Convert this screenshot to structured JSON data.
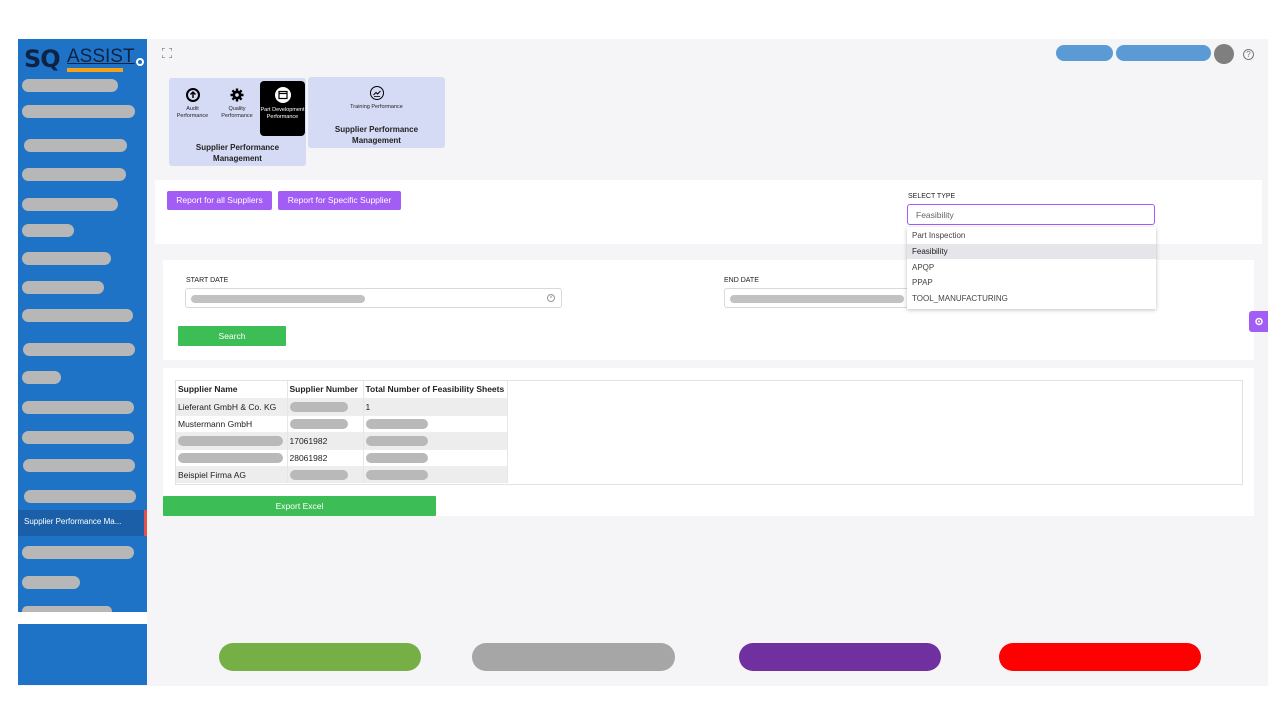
{
  "brand": {
    "logo_sq": "SQ",
    "logo_assist": "ASSIST"
  },
  "sidebar": {
    "active_item": "Supplier Performance Ma..."
  },
  "modules": {
    "group1": {
      "title": "Supplier Performance Management",
      "items": [
        {
          "label": "Audit Performance",
          "icon": "upload-circle-icon"
        },
        {
          "label": "Quality Performance",
          "icon": "gear-icon"
        },
        {
          "label": "Part Development Performance",
          "icon": "window-icon"
        }
      ]
    },
    "group2": {
      "title": "Supplier Performance Management",
      "items": [
        {
          "label": "Training Performance",
          "icon": "chart-line-icon"
        }
      ]
    }
  },
  "report": {
    "all_suppliers_label": "Report for all Suppliers",
    "specific_supplier_label": "Report for Specific Supplier",
    "select_type_label": "SELECT TYPE",
    "select_type_value": "Feasibility",
    "options": [
      "Part Inspection",
      "Feasibility",
      "APQP",
      "PPAP",
      "TOOL_MANUFACTURING"
    ],
    "selected_option": "Feasibility"
  },
  "filters": {
    "start_date_label": "START DATE",
    "end_date_label": "END DATE",
    "search_label": "Search"
  },
  "table": {
    "headers": [
      "Supplier Name",
      "Supplier Number",
      "Total Number of Feasibility Sheets"
    ],
    "rows": [
      {
        "name": "Lieferant GmbH & Co. KG",
        "number": "",
        "total": "1"
      },
      {
        "name": "Mustermann GmbH",
        "number": "",
        "total": ""
      },
      {
        "name": "",
        "number": "17061982",
        "total": ""
      },
      {
        "name": "",
        "number": "28061982",
        "total": ""
      },
      {
        "name": "Beispiel Firma AG",
        "number": "",
        "total": ""
      }
    ]
  },
  "export_label": "Export Excel",
  "colors": {
    "sidebar": "#1f73c6",
    "accent_purple": "#a25df5",
    "accent_green": "#3dbd56",
    "legend": [
      "#76af45",
      "#a6a6a6",
      "#7030a0",
      "#ff0000"
    ]
  }
}
